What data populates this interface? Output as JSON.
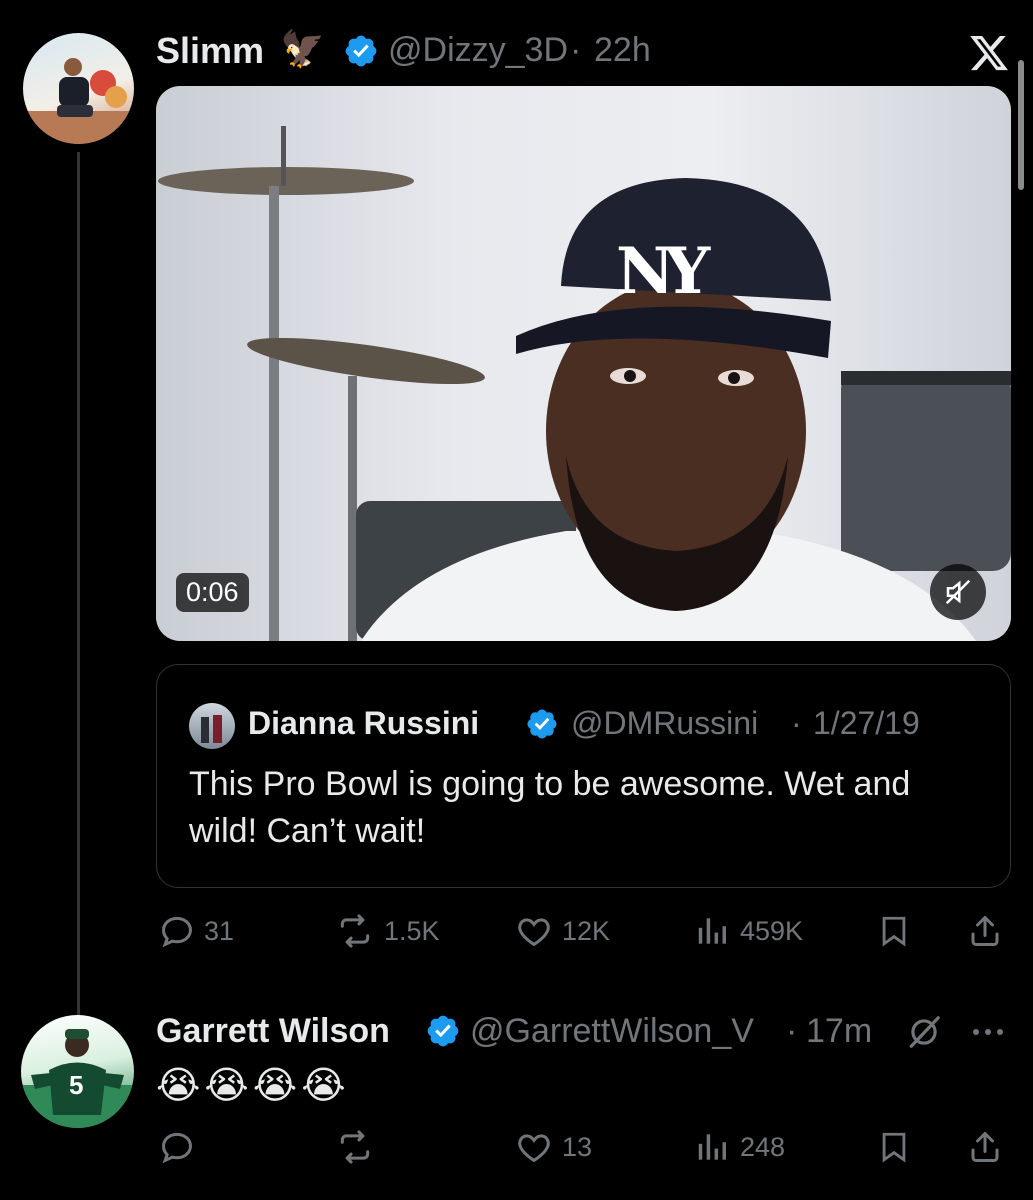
{
  "close_icon": "x-logo-icon",
  "tweet1": {
    "display_name": "Slimm",
    "name_emoji": "🦅",
    "handle": "@Dizzy_3D",
    "separator": "·",
    "time": "22h",
    "video": {
      "duration": "0:06",
      "muted": true,
      "cap_text": "NY"
    },
    "quote": {
      "display_name": "Dianna Russini",
      "handle": "@DMRussini",
      "separator": "·",
      "date": "1/27/19",
      "text": "This Pro Bowl is going to be awesome. Wet and wild! Can’t wait!"
    },
    "actions": {
      "replies": "31",
      "reposts": "1.5K",
      "likes": "12K",
      "views": "459K"
    }
  },
  "tweet2": {
    "display_name": "Garrett Wilson",
    "handle": "@GarrettWilson_V",
    "separator": "·",
    "time": "17m",
    "jersey_number": "5",
    "text": "😭😭😭😭",
    "actions": {
      "replies": "",
      "reposts": "",
      "likes": "13",
      "views": "248"
    }
  },
  "colors": {
    "background": "#000000",
    "text": "#e7e9ea",
    "muted": "#71767b",
    "verified": "#1d9bf0",
    "border": "#2f3336"
  }
}
